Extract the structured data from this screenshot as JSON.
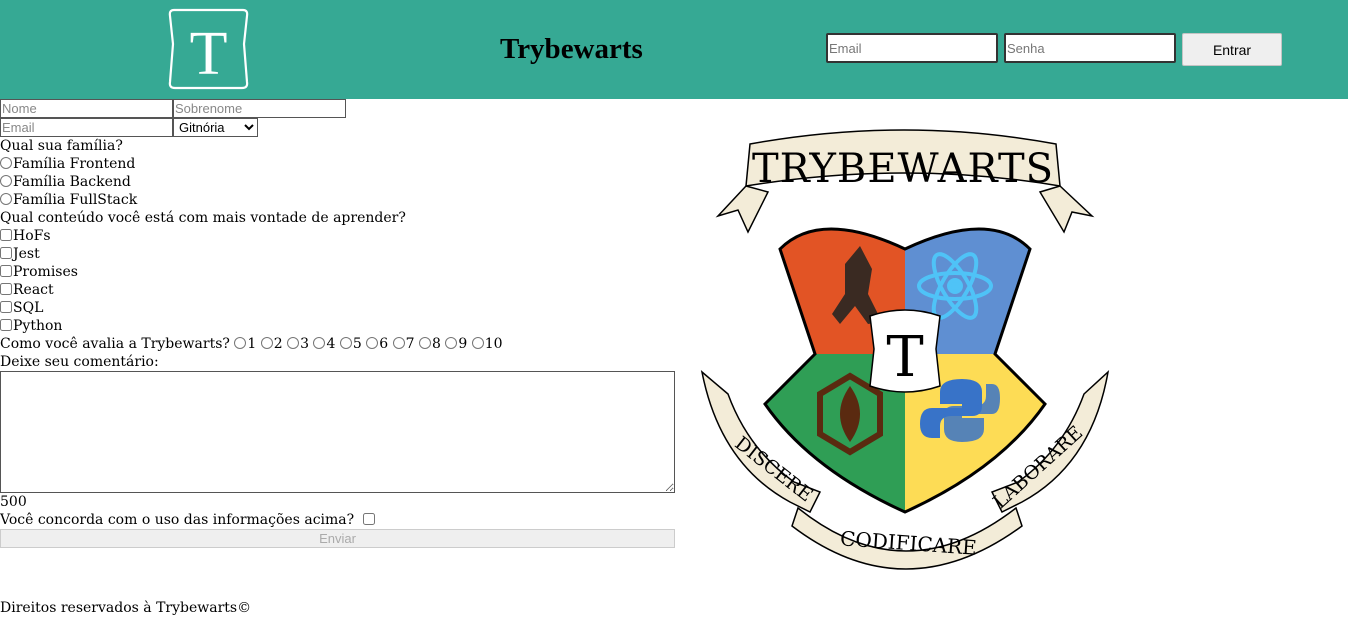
{
  "header": {
    "logo_letter": "T",
    "title": "Trybewarts",
    "login": {
      "email_placeholder": "Email",
      "password_placeholder": "Senha",
      "button_label": "Entrar"
    }
  },
  "form": {
    "name_placeholder": "Nome",
    "lastname_placeholder": "Sobrenome",
    "email_placeholder": "Email",
    "house_selected": "Gitnória",
    "family_question": "Qual sua família?",
    "families": [
      "Família Frontend",
      "Família Backend",
      "Família FullStack"
    ],
    "content_question": "Qual conteúdo você está com mais vontade de aprender?",
    "subjects": [
      "HoFs",
      "Jest",
      "Promises",
      "React",
      "SQL",
      "Python"
    ],
    "rate_question": "Como você avalia a Trybewarts?",
    "rates": [
      "1",
      "2",
      "3",
      "4",
      "5",
      "6",
      "7",
      "8",
      "9",
      "10"
    ],
    "comment_label": "Deixe seu comentário:",
    "counter": "500",
    "agreement_label": "Você concorda com o uso das informações acima?",
    "submit_label": "Enviar"
  },
  "crest": {
    "banner": "TRYBEWARTS",
    "center_letter": "T",
    "motto_left": "DISCERE",
    "motto_center": "CODIFICARE",
    "motto_right": "LABORARE",
    "colors": {
      "red": "#e25425",
      "blue": "#5f8fd2",
      "green": "#2f9e55",
      "yellow": "#fddc55",
      "scroll": "#f3ecd8"
    }
  },
  "footer": {
    "text": "Direitos reservados à Trybewarts©"
  }
}
